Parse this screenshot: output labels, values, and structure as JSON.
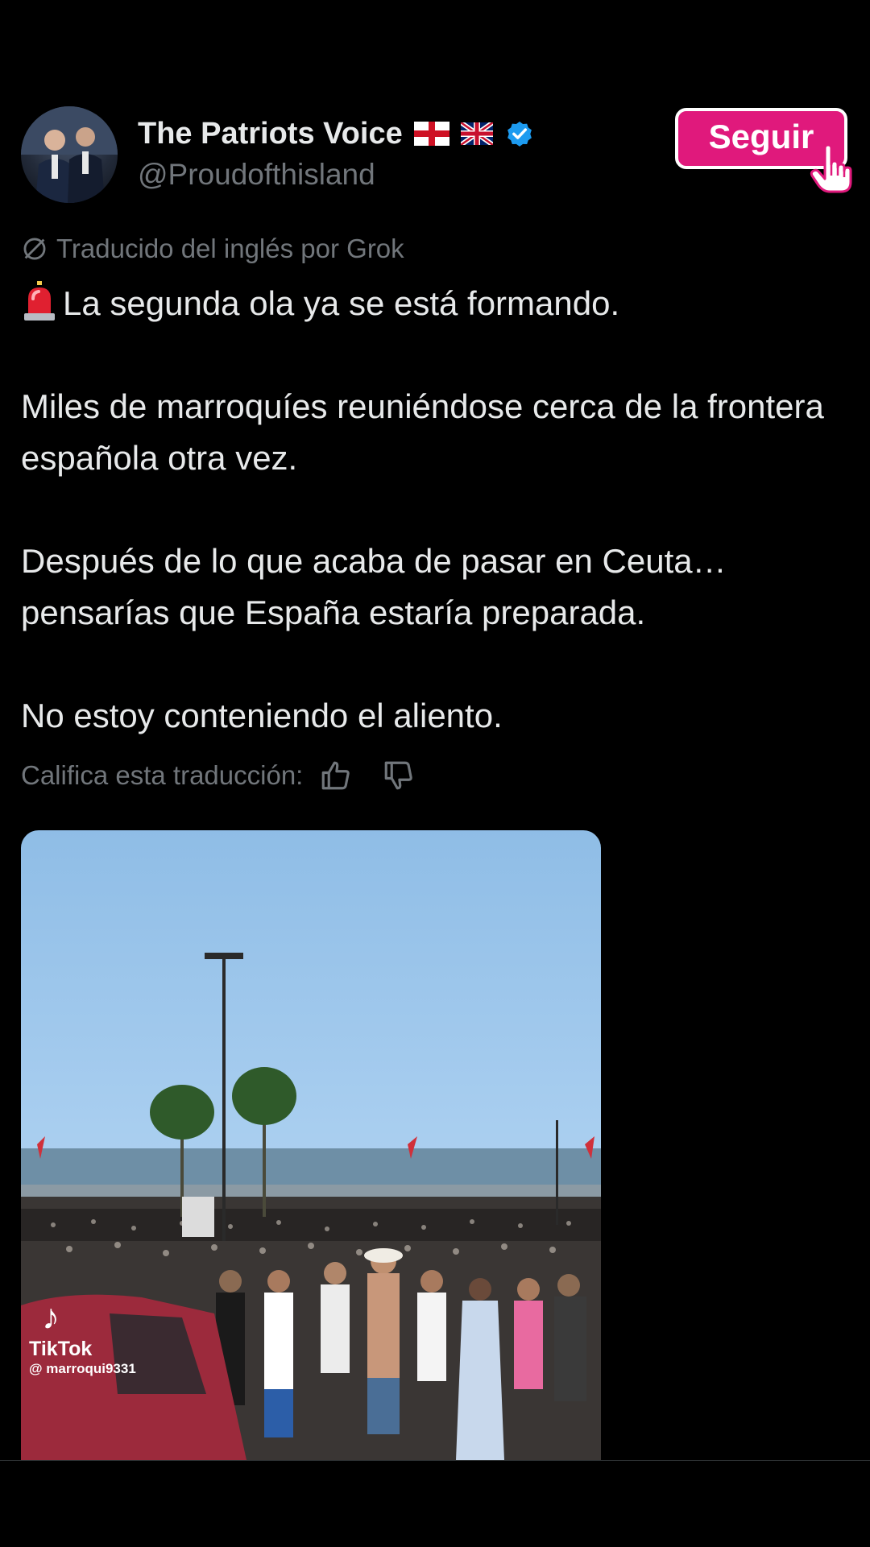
{
  "header": {
    "display_name": "The Patriots Voice",
    "handle": "@Proudofthisland",
    "verified_icon": "verified-badge-icon",
    "flags": [
      "england-flag-icon",
      "uk-flag-icon"
    ],
    "follow_label": "Seguir",
    "follow_color": "#e0197c"
  },
  "translation": {
    "notice": "Traducido del inglés por Grok",
    "rate_label": "Califica esta traducción:"
  },
  "tweet": {
    "line1": "La segunda ola ya se está formando.",
    "line2": "Miles de marroquíes reuniéndose cerca de la frontera española otra vez.",
    "line3": "Después de lo que acaba de pasar en Ceuta… pensarías que España estaría preparada.",
    "line4": "No estoy conteniendo el aliento."
  },
  "media": {
    "watermark_name": "TikTok",
    "watermark_user": "@ marroqui9331"
  },
  "colors": {
    "background": "#000000",
    "text": "#e7e9ea",
    "muted": "#71767b",
    "verified": "#1d9bf0"
  }
}
